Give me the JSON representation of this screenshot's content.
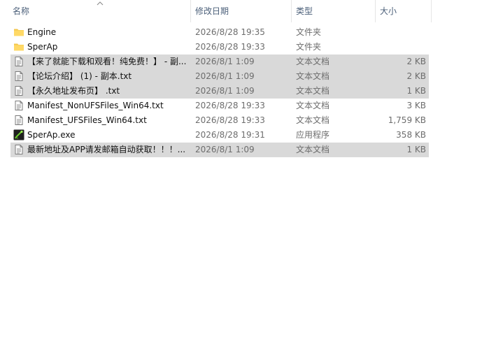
{
  "columns": {
    "name": "名称",
    "date": "修改日期",
    "type": "类型",
    "size": "大小"
  },
  "files": [
    {
      "name": "Engine",
      "date": "2026/8/28 19:35",
      "type": "文件夹",
      "size": "",
      "icon": "folder-icon",
      "selected": false
    },
    {
      "name": "SperAp",
      "date": "2026/8/28 19:33",
      "type": "文件夹",
      "size": "",
      "icon": "folder-icon",
      "selected": false
    },
    {
      "name": "【来了就能下载和观看！纯免费！】 - 副...",
      "date": "2026/8/1 1:09",
      "type": "文本文档",
      "size": "2 KB",
      "icon": "text-file-icon",
      "selected": true
    },
    {
      "name": "【论坛介绍】 (1) - 副本.txt",
      "date": "2026/8/1 1:09",
      "type": "文本文档",
      "size": "2 KB",
      "icon": "text-file-icon",
      "selected": true
    },
    {
      "name": "【永久地址发布页】 .txt",
      "date": "2026/8/1 1:09",
      "type": "文本文档",
      "size": "1 KB",
      "icon": "text-file-icon",
      "selected": true
    },
    {
      "name": "Manifest_NonUFSFiles_Win64.txt",
      "date": "2026/8/28 19:33",
      "type": "文本文档",
      "size": "3 KB",
      "icon": "text-file-icon",
      "selected": false
    },
    {
      "name": "Manifest_UFSFiles_Win64.txt",
      "date": "2026/8/28 19:33",
      "type": "文本文档",
      "size": "1,759 KB",
      "icon": "text-file-icon",
      "selected": false
    },
    {
      "name": "SperAp.exe",
      "date": "2026/8/28 19:31",
      "type": "应用程序",
      "size": "358 KB",
      "icon": "application-icon",
      "selected": false
    },
    {
      "name": "最新地址及APP请发邮箱自动获取！！！...",
      "date": "2026/8/1 1:09",
      "type": "文本文档",
      "size": "1 KB",
      "icon": "text-file-icon",
      "selected": true
    }
  ]
}
